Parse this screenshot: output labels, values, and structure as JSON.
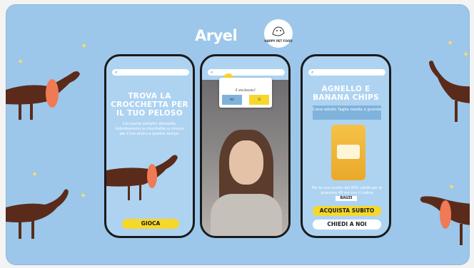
{
  "header": {
    "logo_text": "Aryel",
    "partner_badge": "HAPPY PET FOOD"
  },
  "phone1": {
    "search_icon": "search-icon",
    "title": "TROVA LA CROCCHETTA PER IL TUO PELOSO",
    "description": "Con poche semplici domande, individueremo la crocchetta su misura per il tuo amico a quattro zampe.",
    "cta": "GIOCA"
  },
  "phone2": {
    "ar_question": "È sterilizzato?",
    "answer_no": "NO",
    "answer_yes": "SÌ"
  },
  "phone3": {
    "title": "AGNELLO E BANANA CHIPS",
    "subtitle": "Cane adulto Taglia media o grande",
    "offer_text": "Per te uno sconto del 20% valido per le prossime 48 ore con il codice",
    "code": "BAUZI",
    "cta_primary": "ACQUISTA SUBITO",
    "cta_secondary": "CHIEDI A NOI"
  },
  "colors": {
    "background": "#9cc7ea",
    "accent": "#f6d82b",
    "dog": "#5a2b1a",
    "ear": "#f07a55"
  }
}
